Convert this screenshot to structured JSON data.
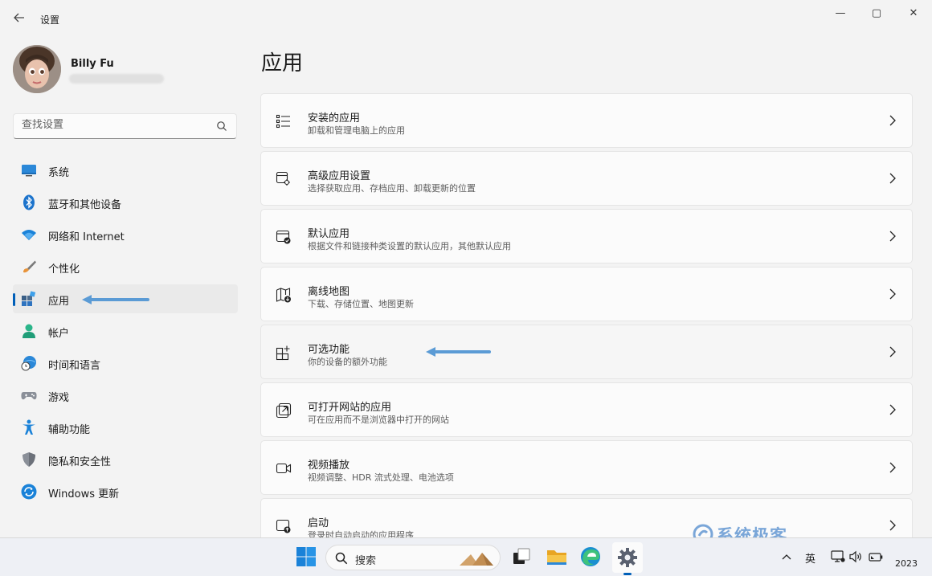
{
  "window": {
    "title": "设置",
    "controls": {
      "minimize": "—",
      "maximize": "▢",
      "close": "✕"
    }
  },
  "profile": {
    "name": "Billy Fu"
  },
  "search": {
    "placeholder": "查找设置"
  },
  "sidebar": {
    "items": [
      {
        "label": "系统",
        "icon": "monitor-icon"
      },
      {
        "label": "蓝牙和其他设备",
        "icon": "bluetooth-icon"
      },
      {
        "label": "网络和 Internet",
        "icon": "wifi-icon"
      },
      {
        "label": "个性化",
        "icon": "brush-icon"
      },
      {
        "label": "应用",
        "icon": "apps-icon",
        "active": true
      },
      {
        "label": "帐户",
        "icon": "person-icon"
      },
      {
        "label": "时间和语言",
        "icon": "globe-clock-icon"
      },
      {
        "label": "游戏",
        "icon": "gamepad-icon"
      },
      {
        "label": "辅助功能",
        "icon": "accessibility-icon"
      },
      {
        "label": "隐私和安全性",
        "icon": "shield-icon"
      },
      {
        "label": "Windows 更新",
        "icon": "update-icon"
      }
    ]
  },
  "main": {
    "title": "应用",
    "cards": [
      {
        "title": "安装的应用",
        "subtitle": "卸载和管理电脑上的应用",
        "icon": "list-icon"
      },
      {
        "title": "高级应用设置",
        "subtitle": "选择获取应用、存档应用、卸载更新的位置",
        "icon": "app-settings-icon"
      },
      {
        "title": "默认应用",
        "subtitle": "根据文件和链接种类设置的默认应用，其他默认应用",
        "icon": "default-apps-icon"
      },
      {
        "title": "离线地图",
        "subtitle": "下载、存储位置、地图更新",
        "icon": "map-icon"
      },
      {
        "title": "可选功能",
        "subtitle": "你的设备的额外功能",
        "icon": "optional-features-icon"
      },
      {
        "title": "可打开网站的应用",
        "subtitle": "可在应用而不是浏览器中打开的网站",
        "icon": "open-website-icon"
      },
      {
        "title": "视频播放",
        "subtitle": "视频调整、HDR 流式处理、电池选项",
        "icon": "video-icon"
      },
      {
        "title": "启动",
        "subtitle": "登录时自动启动的应用程序",
        "icon": "startup-icon"
      }
    ]
  },
  "taskbar": {
    "search_label": "搜索",
    "ime": "英",
    "clock": "2023"
  },
  "watermark": {
    "text": "系统极客"
  },
  "colors": {
    "accent": "#005fb8",
    "annotation_arrow": "#5b9bd5"
  }
}
